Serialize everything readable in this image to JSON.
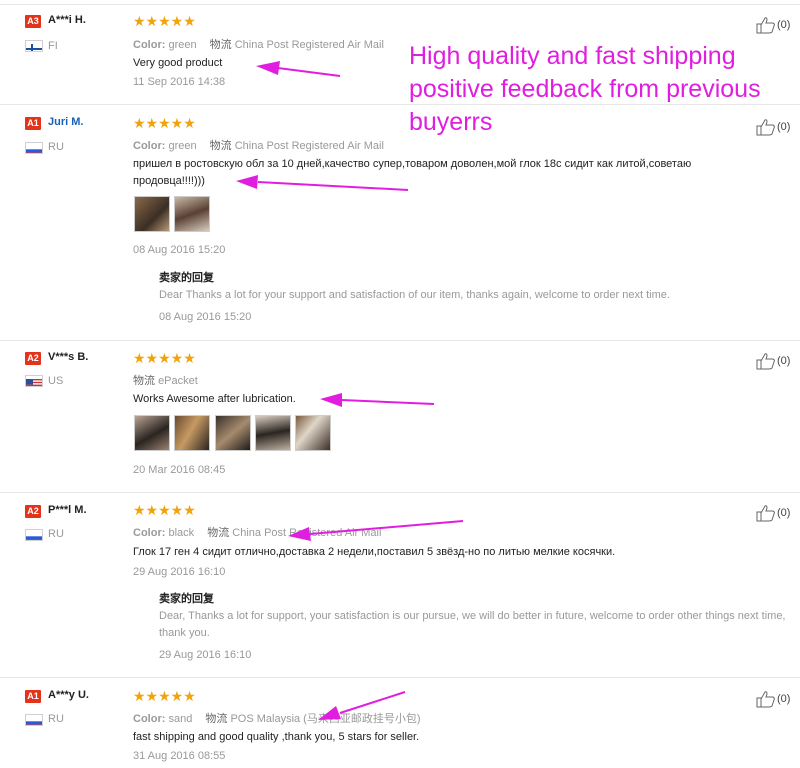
{
  "annotation": {
    "lines": [
      "High quality and fast shipping",
      "positive feedback from previous",
      "buyerrs"
    ]
  },
  "colors": {
    "accent": "#e01ee0",
    "badge": "#e3331b",
    "star": "#f0a30a",
    "link": "#1a5fb4"
  },
  "stars_glyph": "★★★★★",
  "reviews": [
    {
      "badge": "A3",
      "name": "A***i H.",
      "country": "FI",
      "color_label": "Color:",
      "color": "green",
      "logistics_label": "物流",
      "logistics": "China Post Registered Air Mail",
      "text": "Very good product",
      "date": "11 Sep 2016 14:38",
      "likes": "(0)",
      "rating": 5
    },
    {
      "badge": "A1",
      "name": "Juri M.",
      "country": "RU",
      "color_label": "Color:",
      "color": "green",
      "logistics_label": "物流",
      "logistics": "China Post Registered Air Mail",
      "text": "пришел в ростовскую обл за 10 дней,качество супер,товаром доволен,мой глок 18с сидит как литой,советаю",
      "text2": "продовца!!!!)))",
      "date": "08 Aug 2016 15:20",
      "reply_title": "卖家的回复",
      "reply": "Dear Thanks a lot for your support and satisfaction of our item, thanks again, welcome to order next time.",
      "reply_date": "08 Aug 2016 15:20",
      "likes": "(0)",
      "rating": 5
    },
    {
      "badge": "A2",
      "name": "V***s B.",
      "country": "US",
      "logistics_label": "物流",
      "logistics": "ePacket",
      "text": "Works Awesome after lubrication.",
      "date": "20 Mar 2016 08:45",
      "likes": "(0)",
      "rating": 5
    },
    {
      "badge": "A2",
      "name": "P***l M.",
      "country": "RU",
      "color_label": "Color:",
      "color": "black",
      "logistics_label": "物流",
      "logistics": "China Post Registered Air Mail",
      "text": "Глок 17 ген 4 сидит отлично,доставка 2 недели,поставил 5 звёзд-но по литью мелкие косячки.",
      "date": "29 Aug 2016 16:10",
      "reply_title": "卖家的回复",
      "reply": "Dear, Thanks a lot for support, your satisfaction is our pursue, we will do better in future, welcome to order other things next time, thank you.",
      "reply_date": "29 Aug 2016 16:10",
      "likes": "(0)",
      "rating": 5
    },
    {
      "badge": "A1",
      "name": "A***y U.",
      "country": "RU",
      "color_label": "Color:",
      "color": "sand",
      "logistics_label": "物流",
      "logistics": "POS Malaysia (马来西亚邮政挂号小包)",
      "text": "fast shipping and good quality ,thank you, 5 stars for seller.",
      "date": "31 Aug 2016 08:55",
      "likes": "(0)",
      "rating": 5
    }
  ]
}
